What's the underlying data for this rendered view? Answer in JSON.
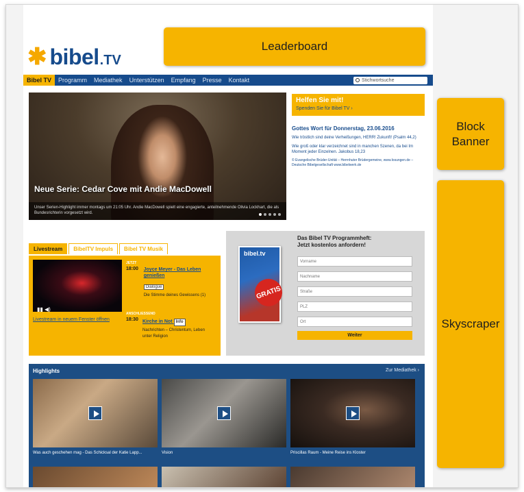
{
  "logo": {
    "text": "bibel",
    "suffix": ".TV"
  },
  "ads": {
    "leaderboard": "Leaderboard",
    "block_line1": "Block",
    "block_line2": "Banner",
    "skyscraper": "Skyscraper"
  },
  "nav": {
    "items": [
      "Bibel TV",
      "Programm",
      "Mediathek",
      "Unterstützen",
      "Empfang",
      "Presse",
      "Kontakt"
    ],
    "search_placeholder": "Stichwortsuche"
  },
  "hero": {
    "title": "Neue Serie: Cedar Cove mit Andie MacDowell",
    "desc": "Unser Serien-Highlight immer montags um 21:05 Uhr. Andie MacDowell spielt eine engagierte, anteilnehmende Olivia Lockhart, die als Bundesrichterin vorgesetzt wird."
  },
  "help": {
    "title": "Helfen Sie mit!",
    "link": "Spenden Sie für Bibel TV ›"
  },
  "word": {
    "title": "Gottes Wort für Donnerstag, 23.06.2016",
    "text1": "Wie tröstlich sind deine Verheißungen, HERR! Zukunft! (Psalm 44,2)",
    "text2": "Wie groß oder klar verzeichnet sind in manchen Szenen, da bei Im Moment jeder Einzelnen. Jakobus 18,23",
    "small": "© Evangelische Brüder-Unität – Herrnhuter Brüdergemeine, www.losungen.de – Deutsche Bibelgesellschaft www.bibelwerk.de"
  },
  "live": {
    "tabs": [
      "Livestream",
      "BibelTV Impuls",
      "Bibel TV Musik"
    ],
    "link": "Livestream in neuem Fenster öffnen",
    "controls": "▮▮  ◀)",
    "head1": "JETZT",
    "time1": "18:00",
    "title1": "Joyce Meyer - Das Leben genießen",
    "badge1": "Dialogue",
    "sub1": "Die Stimme deines Gewissens (1)",
    "head2": "ANSCHLIESSEND",
    "time2": "18:30",
    "title2": "Kirche in Not",
    "badge2": "Info",
    "sub2": "Nachrichten – Christentum, Leben unter Religion"
  },
  "form": {
    "booklet_logo": "bibel.tv",
    "gratis": "GRATIS",
    "title_line1": "Das Bibel TV Programmheft:",
    "title_line2": "Jetzt kostenlos anfordern!",
    "fields": [
      "Vorname",
      "Nachname",
      "Straße",
      "PLZ",
      "Ort"
    ],
    "button": "Weiter"
  },
  "highlights": {
    "title": "Highlights",
    "more": "Zur Mediathek ›",
    "captions": [
      "Was auch geschehen mag - Das Schicksal der Katie Lapp...",
      "Vision",
      "Priscillas Raum - Meine Reise ins Kloster"
    ]
  }
}
